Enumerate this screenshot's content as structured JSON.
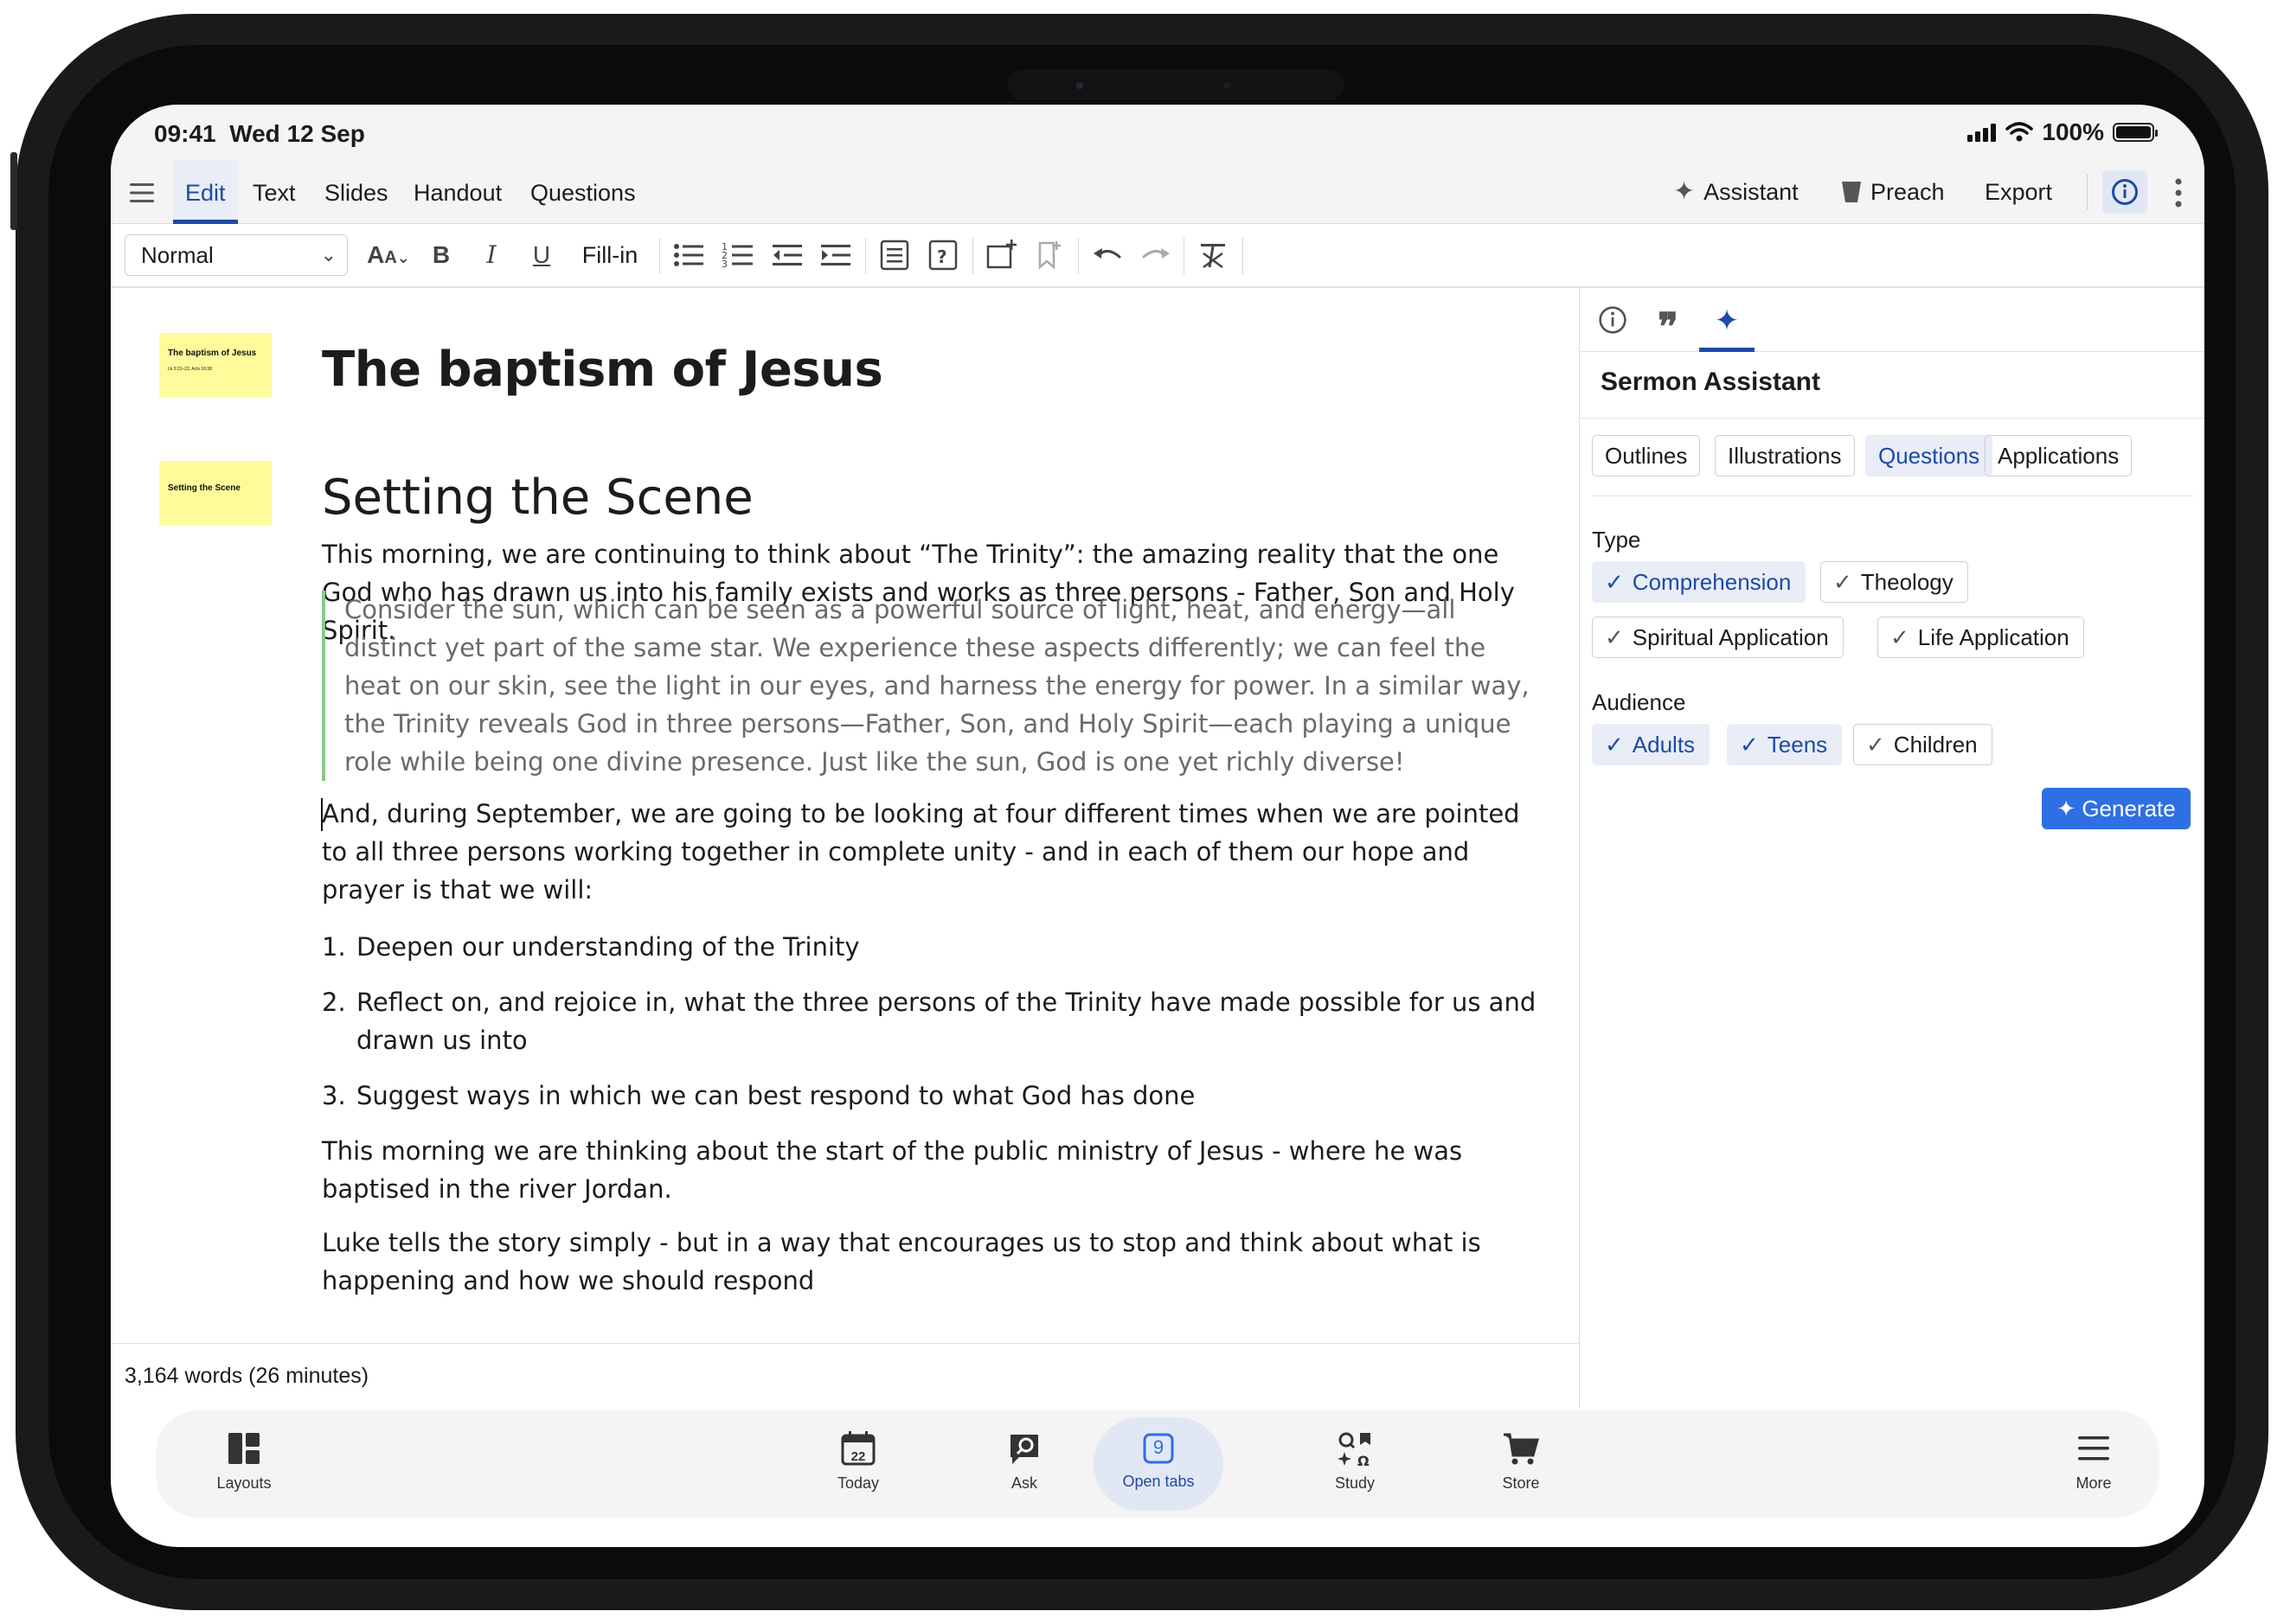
{
  "status": {
    "time": "09:41",
    "date": "Wed 12 Sep",
    "battery": "100%"
  },
  "menu": {
    "tabs": [
      "Edit",
      "Text",
      "Slides",
      "Handout",
      "Questions"
    ],
    "right": {
      "assistant": "Assistant",
      "preach": "Preach",
      "export": "Export"
    }
  },
  "toolbar": {
    "style": "Normal",
    "fill_in": "Fill-in"
  },
  "document": {
    "title": "The baptism of Jesus",
    "thumb1": {
      "title": "The baptism of Jesus",
      "ref": "Lk 3:21–22, Acts 10:38"
    },
    "thumb2": {
      "title": "Setting the Scene"
    },
    "section": "Setting the Scene",
    "p1": "This morning, we are continuing to think about “The Trinity”: the amazing reality that the one God who has drawn us into his family exists and works as three persons - Father, Son and Holy Spirit.",
    "quote": "Consider the sun, which can be seen as a powerful source of light, heat, and energy—all distinct yet part of the same star. We experience these aspects differently; we can feel the heat on our skin, see the light in our eyes, and harness the energy for power. In a similar way, the Trinity reveals God in three persons—Father, Son, and Holy Spirit—each playing a unique role while being one divine presence. Just like the sun, God is one yet richly diverse!",
    "p2": "And, during September, we are going to be looking at four different times when we are pointed to all three persons working together in complete unity - and in each of them our hope and prayer is that we will:",
    "list": [
      {
        "num": "1.",
        "text": "Deepen our understanding of the Trinity"
      },
      {
        "num": "2.",
        "text": "Reflect on, and rejoice in, what the three persons of the Trinity have made possible for us and drawn us into"
      },
      {
        "num": "3.",
        "text": "Suggest ways in which we can best respond to what God has done"
      }
    ],
    "p3": "This morning we are thinking about the start of the public ministry of Jesus - where he was  baptised in the river Jordan.",
    "p4": "Luke tells the story simply - but in a way that encourages us to stop and think about what is happening and how we should respond",
    "word_count": "3,164 words (26 minutes)"
  },
  "panel": {
    "title": "Sermon Assistant",
    "segments": [
      "Outlines",
      "Illustrations",
      "Questions",
      "Applications"
    ],
    "active_segment": "Questions",
    "type_label": "Type",
    "types": [
      {
        "label": "Comprehension",
        "selected": true
      },
      {
        "label": "Theology",
        "selected": false
      },
      {
        "label": "Spiritual Application",
        "selected": false
      },
      {
        "label": "Life Application",
        "selected": false
      }
    ],
    "audience_label": "Audience",
    "audiences": [
      {
        "label": "Adults",
        "selected": true
      },
      {
        "label": "Teens",
        "selected": true
      },
      {
        "label": "Children",
        "selected": false
      }
    ],
    "generate": "Generate"
  },
  "dock": {
    "layouts": "Layouts",
    "today": "Today",
    "today_day": "22",
    "ask": "Ask",
    "open_tabs": "Open tabs",
    "open_tabs_count": "9",
    "study": "Study",
    "store": "Store",
    "more": "More"
  },
  "colors": {
    "accent": "#1e4aa6",
    "generate": "#2f6fe4",
    "slide_thumb": "#fffb9a",
    "quote_bar": "#8cc98a"
  }
}
